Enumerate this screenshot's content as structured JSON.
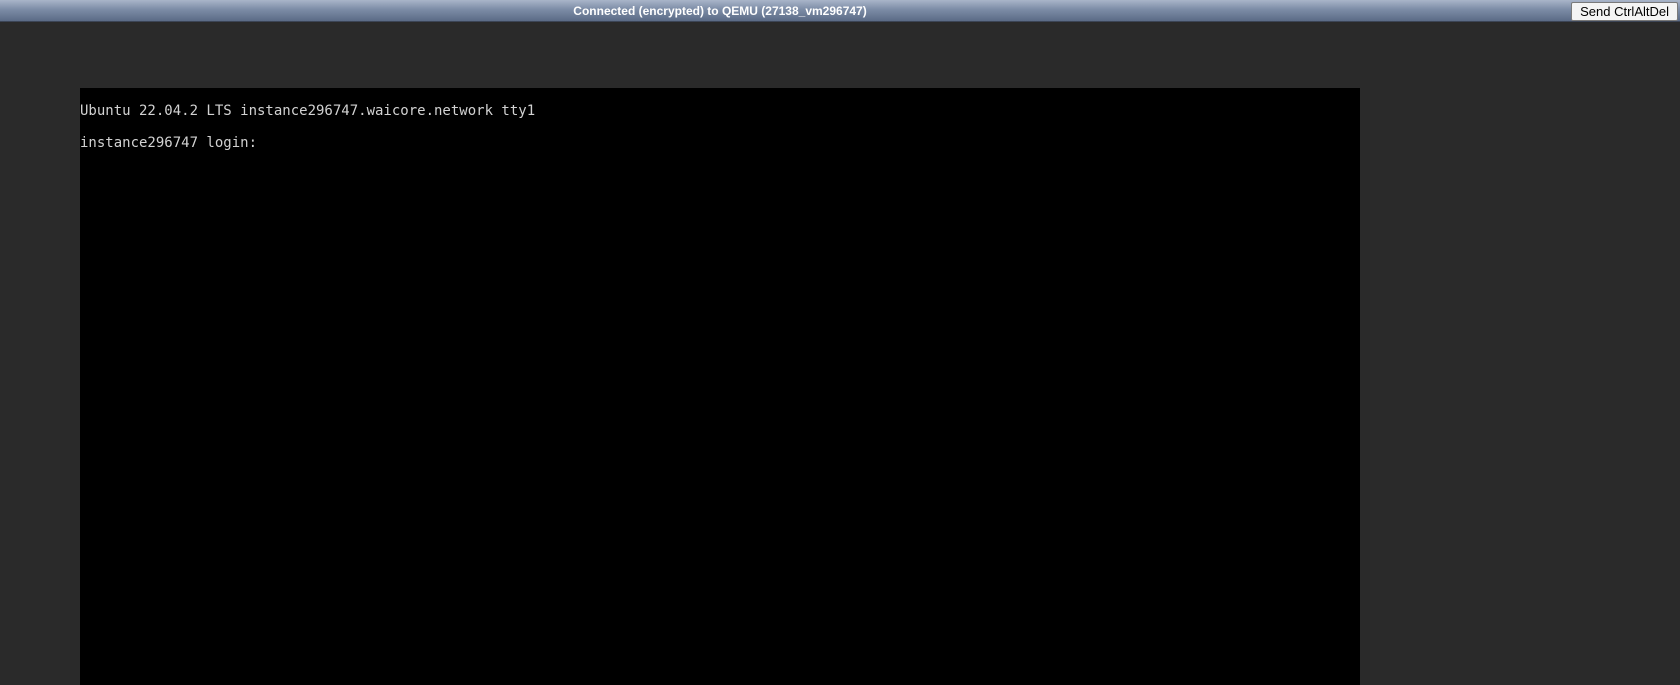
{
  "status_bar": {
    "title": "Connected (encrypted) to QEMU (27138_vm296747)",
    "send_button_label": "Send CtrlAltDel"
  },
  "console": {
    "lines": [
      "Ubuntu 22.04.2 LTS instance296747.waicore.network tty1",
      "instance296747 login:"
    ]
  },
  "colors": {
    "page_background": "#2a2a2a",
    "console_background": "#000000",
    "console_text": "#d2d2d2",
    "status_text": "#ffffff"
  }
}
